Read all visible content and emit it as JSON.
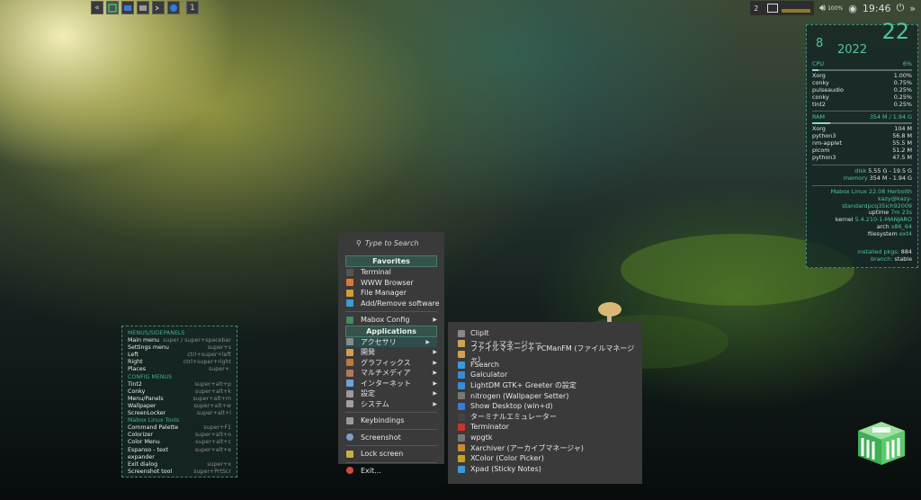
{
  "taskbar": {
    "workspace": "1"
  },
  "tray": {
    "desktop_num": "2",
    "volume": "100%",
    "time": "19:46"
  },
  "conky": {
    "day": "8",
    "year": "2022",
    "month_day": "22",
    "cpu_label": "CPU",
    "cpu_pct": "6%",
    "cpu_fraction": 0.06,
    "cpu_procs": [
      {
        "name": "Xorg",
        "val": "1.00%"
      },
      {
        "name": "conky",
        "val": "0.75%"
      },
      {
        "name": "pulseaudio",
        "val": "0.25%"
      },
      {
        "name": "conky",
        "val": "0.25%"
      },
      {
        "name": "tint2",
        "val": "0.25%"
      }
    ],
    "ram_label": "RAM",
    "ram_val": "354 M / 1.94 G",
    "ram_fraction": 0.18,
    "ram_procs": [
      {
        "name": "Xorg",
        "val": "104 M"
      },
      {
        "name": "python3",
        "val": "56.8 M"
      },
      {
        "name": "nm-applet",
        "val": "55.5 M"
      },
      {
        "name": "picom",
        "val": "51.2 M"
      },
      {
        "name": "python3",
        "val": "47.5 M"
      }
    ],
    "disk_label": "disk",
    "disk_val": "5.55 G - 19.5 G",
    "memory_label": "memory",
    "memory_val": "354 M - 1.94 G",
    "os": "Mabox Linux 22.08 Herbolth",
    "host": "kazy@kazy-standardpcq35ich92009",
    "uptime_label": "uptime",
    "uptime_val": "7m 23s",
    "kernel_label": "kernel",
    "kernel_val": "5.4.210-1-MANJARO",
    "arch_label": "arch",
    "arch_val": "x86_64",
    "fs_label": "filesystem",
    "fs_val": "ext4",
    "pkgs_label": "installed pkgs:",
    "pkgs_val": "884",
    "branch_label": "branch:",
    "branch_val": "stable"
  },
  "keys": {
    "sections": [
      {
        "title": "MENUS/SIDEPANELS",
        "rows": [
          [
            "Main menu",
            "super / super+spacebar"
          ],
          [
            "Settings menu",
            "super+s"
          ],
          [
            "Left",
            "ctrl+super+left"
          ],
          [
            "Right",
            "ctrl+super+right"
          ],
          [
            "Places",
            "super+."
          ]
        ]
      },
      {
        "title": "CONFIG MENUS",
        "rows": [
          [
            "Tint2",
            "super+alt+p"
          ],
          [
            "Conky",
            "super+alt+k"
          ],
          [
            "Menu/Panels",
            "super+alt+m"
          ],
          [
            "Wallpaper",
            "super+alt+w"
          ],
          [
            "ScreenLocker",
            "super+alt+l"
          ]
        ]
      },
      {
        "title": "Mabox Linux Tools",
        "rows": [
          [
            "Command Palette",
            "super+F1"
          ],
          [
            "Colorizer",
            "super+alt+o"
          ],
          [
            "Color Menu",
            "super+alt+c"
          ],
          [
            "Espanso - text expander",
            "super+alt+e"
          ],
          [
            "Exit dialog",
            "super+x"
          ],
          [
            "Screenshot tool",
            "super+PrtScr"
          ]
        ]
      }
    ]
  },
  "menu": {
    "search_placeholder": "Type to Search",
    "favorites_header": "Favorites",
    "favorites": [
      "Terminal",
      "WWW Browser",
      "File Manager",
      "Add/Remove software"
    ],
    "mabox_config": "Mabox Config",
    "applications_header": "Applications",
    "applications": [
      "アクセサリ",
      "開発",
      "グラフィックス",
      "マルチメディア",
      "インターネット",
      "設定",
      "システム"
    ],
    "keybindings": "Keybindings",
    "screenshot": "Screenshot",
    "lock": "Lock screen",
    "exit": "Exit..."
  },
  "submenu": {
    "items": [
      "ClipIt",
      "ファイルマネージャー",
      "ファイルマネージャ PCManFM (ファイルマネージャ)",
      "FSearch",
      "Galculator",
      "LightDM GTK+ Greeter の設定",
      "nitrogen (Wallpaper Setter)",
      "Show Desktop (win+d)",
      "ターミナルエミュレーター",
      "Terminator",
      "wpgtk",
      "Xarchiver (アーカイブマネージャ)",
      "XColor (Color Picker)",
      "Xpad (Sticky Notes)"
    ]
  }
}
